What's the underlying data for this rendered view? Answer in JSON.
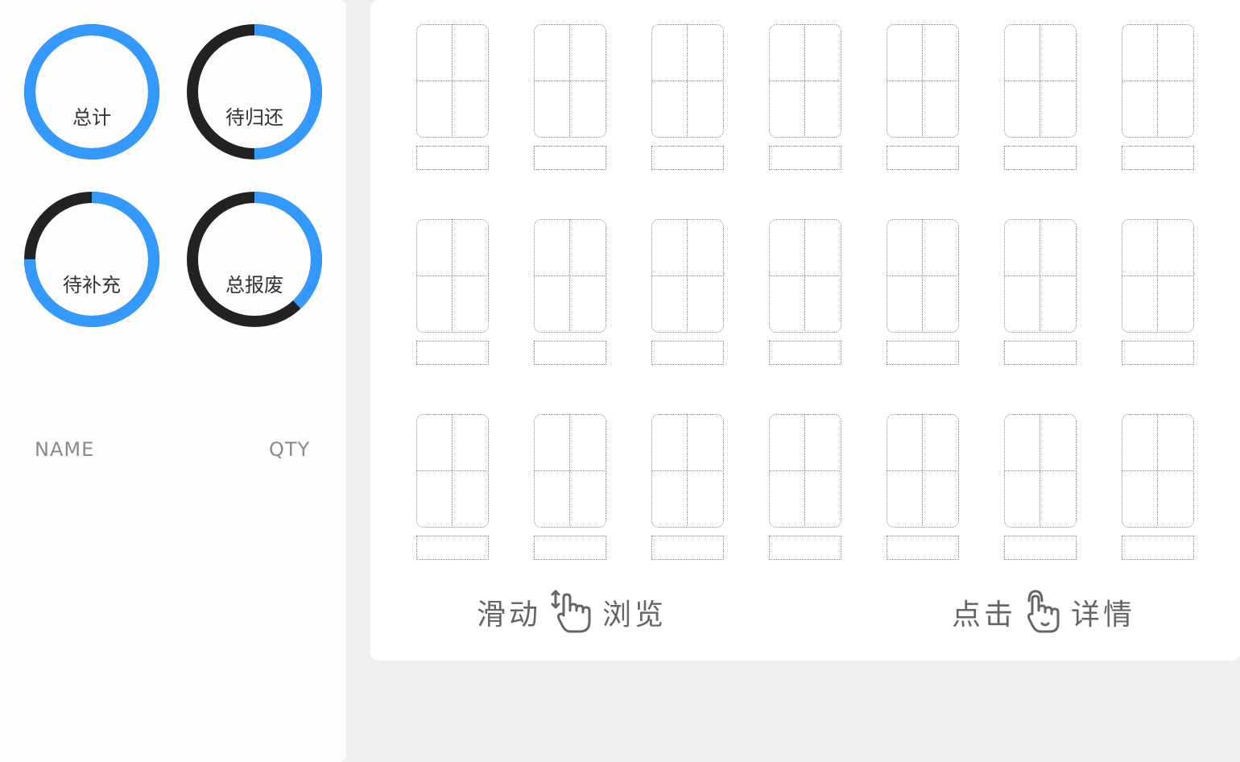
{
  "rings": [
    {
      "label": "总计",
      "progress": 1.0
    },
    {
      "label": "待归还",
      "progress": 0.5
    },
    {
      "label": "待补充",
      "progress": 0.75
    },
    {
      "label": "总报废",
      "progress": 0.38
    }
  ],
  "list_header": {
    "name": "NAME",
    "qty": "QTY"
  },
  "grid": {
    "rows": 3,
    "cols": 7
  },
  "hints": {
    "scroll": {
      "left": "滑动",
      "right": "浏览",
      "icon": "hand-swipe-icon"
    },
    "tap": {
      "left": "点击",
      "right": "详情",
      "icon": "hand-tap-icon"
    }
  },
  "colors": {
    "accent": "#3399ff",
    "track": "#222222",
    "background": "#efefef"
  }
}
